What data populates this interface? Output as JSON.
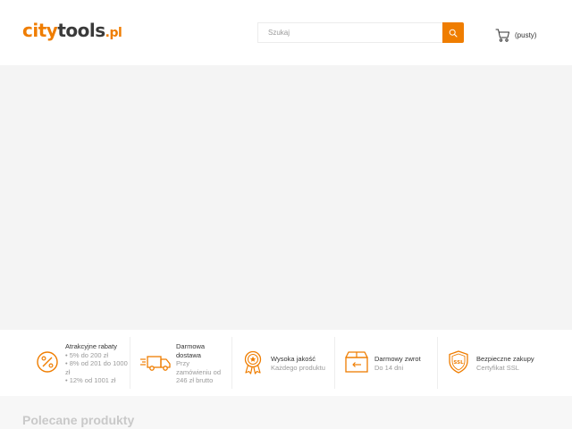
{
  "logo": {
    "part1": "city",
    "part2": "tools",
    "part3": ".pl"
  },
  "search": {
    "placeholder": "Szukaj",
    "value": ""
  },
  "cart": {
    "label": "(pusty)"
  },
  "features": [
    {
      "title": "Atrakcyjne rabaty",
      "lines": [
        "• 5% do 200 zł",
        "• 8% od 201 do 1000",
        "zł",
        "• 12% od 1001 zł"
      ],
      "icon": "percent-icon"
    },
    {
      "title_lines": [
        "Darmowa",
        "dostawa"
      ],
      "lines": [
        "Przy",
        "zamówieniu od",
        "246 zł brutto"
      ],
      "icon": "delivery-truck-icon"
    },
    {
      "title": "Wysoka jakość",
      "lines": [
        "Każdego produktu"
      ],
      "icon": "quality-badge-icon"
    },
    {
      "title": "Darmowy zwrot",
      "lines": [
        "Do 14 dni"
      ],
      "icon": "return-box-icon"
    },
    {
      "title": "Bezpieczne zakupy",
      "lines": [
        "Certyfikat SSL"
      ],
      "icon": "ssl-shield-icon"
    }
  ],
  "recommended": {
    "title": "Polecane produkty"
  },
  "colors": {
    "accent": "#ef7d00",
    "text": "#333333",
    "muted": "#9a9a9a"
  }
}
